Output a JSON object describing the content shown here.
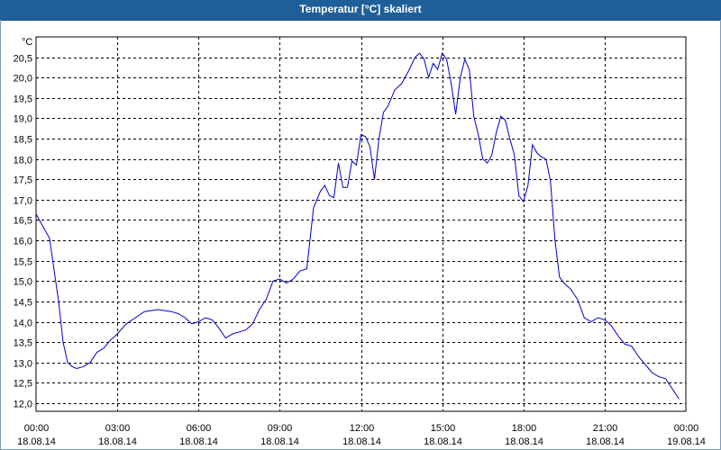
{
  "window": {
    "title": "Temperatur [°C] skaliert"
  },
  "chart_data": {
    "type": "line",
    "title": "Temperatur [°C] skaliert",
    "unit_label": "°C",
    "ylim": [
      11.8,
      21.0
    ],
    "y_ticks": [
      "20,5",
      "20,0",
      "19,5",
      "19,0",
      "18,5",
      "18,0",
      "17,5",
      "17,0",
      "16,5",
      "16,0",
      "15,5",
      "15,0",
      "14,5",
      "14,0",
      "13,5",
      "13,0",
      "12,5",
      "12,0"
    ],
    "x_ticks": [
      {
        "time": "00:00",
        "date": "18.08.14"
      },
      {
        "time": "03:00",
        "date": "18.08.14"
      },
      {
        "time": "06:00",
        "date": "18.08.14"
      },
      {
        "time": "09:00",
        "date": "18.08.14"
      },
      {
        "time": "12:00",
        "date": "18.08.14"
      },
      {
        "time": "15:00",
        "date": "18.08.14"
      },
      {
        "time": "18:00",
        "date": "18.08.14"
      },
      {
        "time": "21:00",
        "date": "18.08.14"
      },
      {
        "time": "00:00",
        "date": "19.08.14"
      }
    ],
    "grid": true,
    "line_color": "#0000cc",
    "series": [
      {
        "x": [
          "18.08.14 00:00",
          "18.08.14 00:30",
          "18.08.14 00:50",
          "18.08.14 01:00",
          "18.08.14 01:10",
          "18.08.14 01:20",
          "18.08.14 01:30",
          "18.08.14 01:45",
          "18.08.14 02:00",
          "18.08.14 02:15",
          "18.08.14 02:30",
          "18.08.14 02:45",
          "18.08.14 03:00",
          "18.08.14 03:20",
          "18.08.14 03:40",
          "18.08.14 04:00",
          "18.08.14 04:30",
          "18.08.14 05:00",
          "18.08.14 05:15",
          "18.08.14 05:30",
          "18.08.14 05:45",
          "18.08.14 06:00",
          "18.08.14 06:15",
          "18.08.14 06:30",
          "18.08.14 06:45",
          "18.08.14 07:00",
          "18.08.14 07:15",
          "18.08.14 07:30",
          "18.08.14 07:45",
          "18.08.14 08:00",
          "18.08.14 08:15",
          "18.08.14 08:30",
          "18.08.14 08:45",
          "18.08.14 09:00",
          "18.08.14 09:15",
          "18.08.14 09:30",
          "18.08.14 09:45",
          "18.08.14 10:00",
          "18.08.14 10:15",
          "18.08.14 10:30",
          "18.08.14 10:40",
          "18.08.14 10:50",
          "18.08.14 11:00",
          "18.08.14 11:10",
          "18.08.14 11:20",
          "18.08.14 11:30",
          "18.08.14 11:40",
          "18.08.14 11:50",
          "18.08.14 12:00",
          "18.08.14 12:10",
          "18.08.14 12:20",
          "18.08.14 12:30",
          "18.08.14 12:40",
          "18.08.14 12:50",
          "18.08.14 13:00",
          "18.08.14 13:15",
          "18.08.14 13:30",
          "18.08.14 13:45",
          "18.08.14 14:00",
          "18.08.14 14:10",
          "18.08.14 14:20",
          "18.08.14 14:30",
          "18.08.14 14:40",
          "18.08.14 14:50",
          "18.08.14 15:00",
          "18.08.14 15:10",
          "18.08.14 15:20",
          "18.08.14 15:30",
          "18.08.14 15:40",
          "18.08.14 15:50",
          "18.08.14 16:00",
          "18.08.14 16:10",
          "18.08.14 16:20",
          "18.08.14 16:30",
          "18.08.14 16:40",
          "18.08.14 16:50",
          "18.08.14 17:00",
          "18.08.14 17:10",
          "18.08.14 17:20",
          "18.08.14 17:30",
          "18.08.14 17:40",
          "18.08.14 17:50",
          "18.08.14 18:00",
          "18.08.14 18:10",
          "18.08.14 18:20",
          "18.08.14 18:30",
          "18.08.14 18:40",
          "18.08.14 18:50",
          "18.08.14 19:00",
          "18.08.14 19:10",
          "18.08.14 19:20",
          "18.08.14 19:30",
          "18.08.14 19:45",
          "18.08.14 20:00",
          "18.08.14 20:15",
          "18.08.14 20:30",
          "18.08.14 20:45",
          "18.08.14 21:00",
          "18.08.14 21:15",
          "18.08.14 21:30",
          "18.08.14 21:45",
          "18.08.14 22:00",
          "18.08.14 22:15",
          "18.08.14 22:30",
          "18.08.14 22:45",
          "18.08.14 23:00",
          "18.08.14 23:15",
          "18.08.14 23:30",
          "18.08.14 23:45"
        ],
        "y": [
          16.65,
          16.05,
          14.5,
          13.5,
          13.0,
          12.9,
          12.85,
          12.9,
          13.0,
          13.25,
          13.35,
          13.55,
          13.7,
          13.95,
          14.1,
          14.25,
          14.3,
          14.25,
          14.2,
          14.1,
          13.95,
          14.0,
          14.1,
          14.05,
          13.85,
          13.6,
          13.7,
          13.75,
          13.8,
          13.95,
          14.3,
          14.55,
          15.0,
          15.05,
          14.95,
          15.05,
          15.25,
          15.3,
          16.8,
          17.2,
          17.35,
          17.1,
          17.05,
          17.9,
          17.3,
          17.3,
          17.95,
          17.85,
          18.6,
          18.55,
          18.3,
          17.5,
          18.5,
          19.15,
          19.3,
          19.7,
          19.85,
          20.15,
          20.5,
          20.6,
          20.45,
          20.0,
          20.35,
          20.2,
          20.6,
          20.45,
          19.85,
          19.1,
          20.0,
          20.45,
          20.2,
          19.05,
          18.6,
          18.0,
          17.9,
          18.1,
          18.65,
          19.05,
          18.95,
          18.5,
          18.1,
          17.1,
          16.95,
          17.35,
          18.35,
          18.15,
          18.05,
          18.0,
          17.45,
          16.0,
          15.1,
          14.95,
          14.8,
          14.55,
          14.1,
          14.0,
          14.1,
          14.05,
          13.9,
          13.65,
          13.45,
          13.4,
          13.15,
          12.95,
          12.75,
          12.65,
          12.6,
          12.35,
          12.1
        ]
      }
    ]
  }
}
